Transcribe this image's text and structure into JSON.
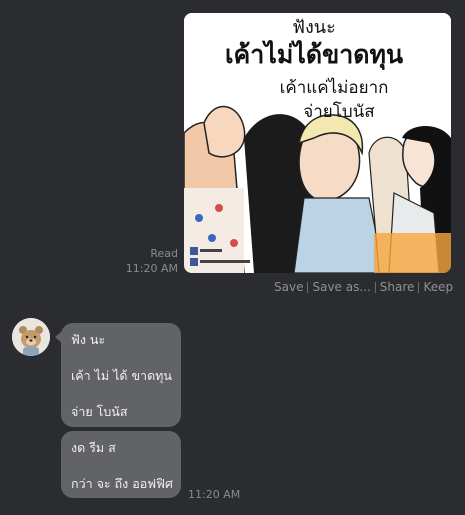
{
  "outgoing_image": {
    "caption_lines": [
      "ฟังนะ",
      "เค้าไม่ได้ขาดทุน",
      "เค้าแค่ไม่อยาก",
      "จ่ายโบนัส"
    ],
    "read_status": "Read",
    "time": "11:20 AM"
  },
  "image_actions": [
    "Save",
    "Save as...",
    "Share",
    "Keep"
  ],
  "incoming": {
    "bubble1_lines": [
      "ฟัง นะ",
      "เค้า ไม่ ได้ ขาดทุน",
      "จ่าย โบนัส"
    ],
    "bubble2_lines": [
      "งด รีม ส",
      "กว่า จะ ถึง ออฟฟิศ"
    ],
    "time": "11:20 AM"
  },
  "colors": {
    "background": "#2b2c2f",
    "bubble": "#626367",
    "meta_text": "#8a8b8f"
  }
}
